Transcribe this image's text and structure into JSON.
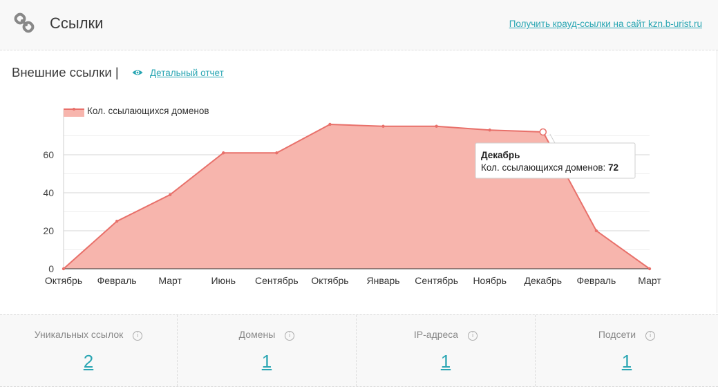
{
  "header": {
    "title": "Ссылки",
    "crowd_link": "Получить крауд-ссылки на сайт kzn.b-urist.ru",
    "icon": "link-icon"
  },
  "section": {
    "title": "Внешние ссылки |",
    "detail_link": "Детальный отчет",
    "eye_icon": "eye-icon"
  },
  "chart_data": {
    "type": "area",
    "categories": [
      "Октябрь",
      "Февраль",
      "Март",
      "Июнь",
      "Сентябрь",
      "Октябрь",
      "Январь",
      "Сентябрь",
      "Ноябрь",
      "Декабрь",
      "Февраль",
      "Март"
    ],
    "series": [
      {
        "name": "Кол. ссылающихся доменов",
        "values": [
          0,
          25,
          39,
          61,
          61,
          76,
          75,
          75,
          73,
          72,
          20,
          0
        ],
        "color": "#e8706a"
      }
    ],
    "yticks": [
      0,
      20,
      40,
      60
    ],
    "ylim": [
      0,
      80
    ],
    "legend": "top-left",
    "tooltip": {
      "title": "Декабрь",
      "label": "Кол. ссылающихся доменов:",
      "value": "72",
      "index": 9
    }
  },
  "stats": [
    {
      "label": "Уникальных ссылок",
      "value": "2"
    },
    {
      "label": "Домены",
      "value": "1"
    },
    {
      "label": "IP-адреса",
      "value": "1"
    },
    {
      "label": "Подсети",
      "value": "1"
    }
  ],
  "colors": {
    "accent": "#2aa6b3",
    "series": "#e8706a",
    "fill": "#f7b5ad"
  }
}
